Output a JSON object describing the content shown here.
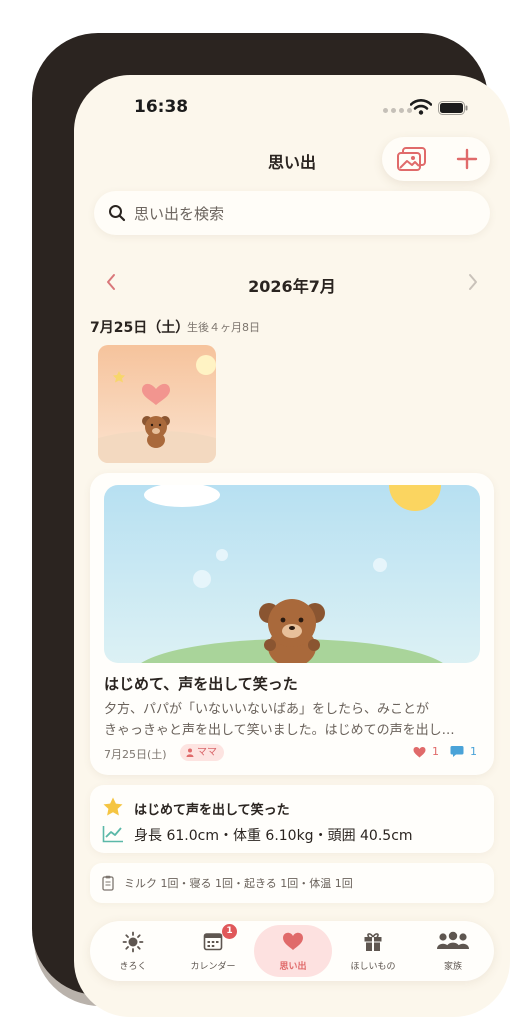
{
  "status_bar": {
    "time": "16:38"
  },
  "header": {
    "title": "思い出",
    "photo_icon": "photos-icon",
    "add_icon": "plus-icon"
  },
  "search": {
    "placeholder": "思い出を検索"
  },
  "month_nav": {
    "title": "2026年7月"
  },
  "date_group": {
    "date": "7月25日（土）",
    "age": "生後４ヶ月8日"
  },
  "memory_card": {
    "title": "はじめて、声を出して笑った",
    "body_line1": "夕方、パパが「いないいないばあ」をしたら、みことが",
    "body_line2": "きゃっきゃと声を出して笑いました。はじめての声を出し…",
    "date": "7月25日(土)",
    "author": "ママ",
    "likes": "1",
    "comments": "1"
  },
  "milestone": {
    "title": "はじめて声を出して笑った",
    "stats": "身長 61.0cm・体重 6.10kg・頭囲 40.5cm"
  },
  "daily_log": {
    "text": "ミルク 1回・寝る 1回・起きる 1回・体温 1回"
  },
  "tabbar": {
    "items": [
      {
        "label": "きろく",
        "icon": "sun-icon"
      },
      {
        "label": "カレンダー",
        "icon": "calendar-icon",
        "badge": "1"
      },
      {
        "label": "思い出",
        "icon": "heart-icon",
        "active": true
      },
      {
        "label": "ほしいもの",
        "icon": "gift-icon"
      },
      {
        "label": "家族",
        "icon": "family-icon"
      }
    ]
  },
  "colors": {
    "accent": "#e06a6a",
    "background": "#fcf7ec",
    "card": "#fffefb",
    "comment": "#4aa3d8"
  }
}
